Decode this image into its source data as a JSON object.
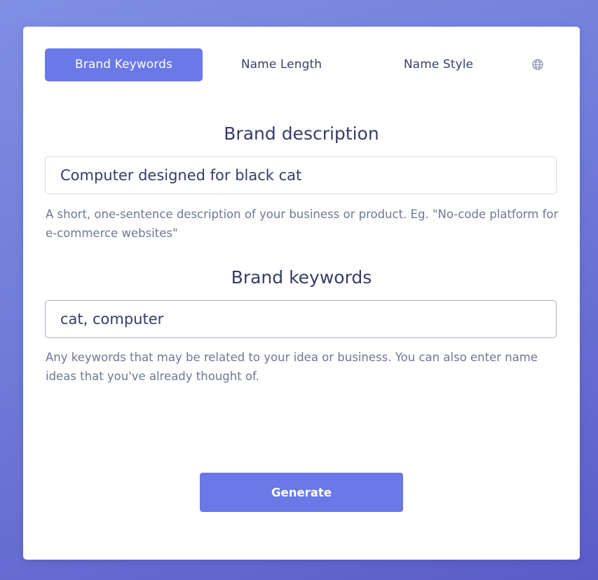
{
  "tabs": [
    {
      "label": "Brand Keywords",
      "active": true
    },
    {
      "label": "Name Length",
      "active": false
    },
    {
      "label": "Name Style",
      "active": false
    }
  ],
  "language_icon": "globe-icon",
  "description": {
    "title": "Brand description",
    "value": "Computer designed for black cat",
    "help": "A short, one-sentence description of your business or product. Eg. \"No-code platform for e-commerce websites\""
  },
  "keywords": {
    "title": "Brand keywords",
    "value": "cat, computer",
    "help": "Any keywords that may be related to your idea or business. You can also enter name ideas that you've already thought of."
  },
  "generate_label": "Generate",
  "colors": {
    "accent": "#6a78e8",
    "heading": "#363c68",
    "help_text": "#6e7891"
  }
}
